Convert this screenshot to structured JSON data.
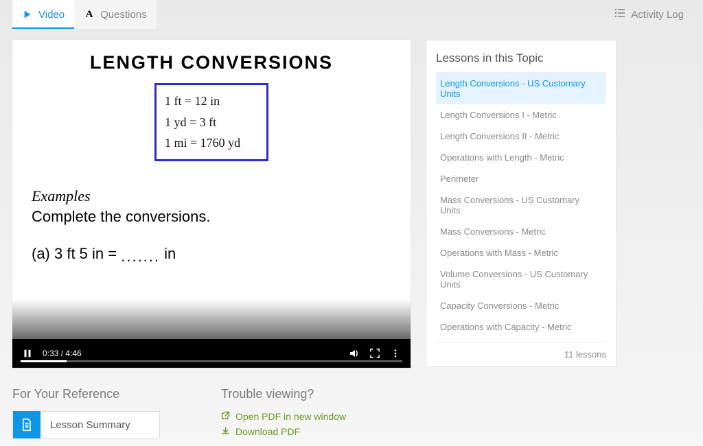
{
  "tabs": {
    "video": "Video",
    "questions": "Questions",
    "activity_log": "Activity Log"
  },
  "video": {
    "title": "LENGTH  CONVERSIONS",
    "conversions": [
      "1 ft  =  12 in",
      "1 yd  =  3 ft",
      "1 mi  =  1760 yd"
    ],
    "examples_head": "Examples",
    "examples_sub": "Complete the conversions.",
    "example_a_left": "(a)  3 ft 5 in  =  ",
    "example_a_right": " in",
    "time_current": "0:33",
    "time_total": "4:46"
  },
  "reference": {
    "head": "For Your Reference",
    "lesson_summary": "Lesson Summary"
  },
  "trouble": {
    "head": "Trouble viewing?",
    "open_pdf": "Open PDF in new window",
    "download_pdf": "Download PDF"
  },
  "lessons": {
    "head": "Lessons in this Topic",
    "items": [
      "Length Conversions - US Customary Units",
      "Length Conversions I - Metric",
      "Length Conversions II - Metric",
      "Operations with Length - Metric",
      "Perimeter",
      "Mass Conversions - US Customary Units",
      "Mass Conversions - Metric",
      "Operations with Mass - Metric",
      "Volume Conversions - US Customary Units",
      "Capacity Conversions - Metric",
      "Operations with Capacity - Metric"
    ],
    "count": "11 lessons"
  }
}
